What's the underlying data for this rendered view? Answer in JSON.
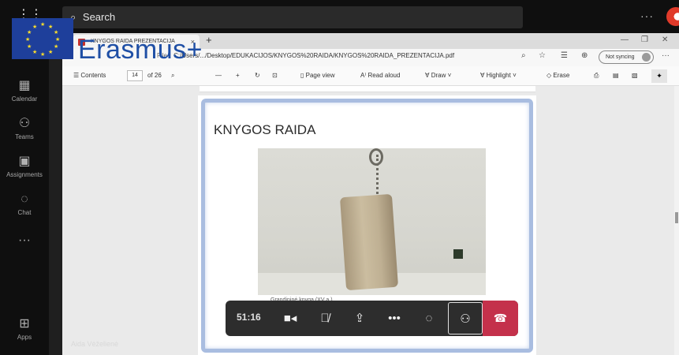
{
  "teams": {
    "search_placeholder": "Search",
    "more": "···",
    "rail": [
      {
        "label": "Calendar",
        "icon": "calendar-icon"
      },
      {
        "label": "Teams",
        "icon": "teams-icon"
      },
      {
        "label": "Assignments",
        "icon": "assignments-icon"
      },
      {
        "label": "Chat",
        "icon": "chat-icon"
      },
      {
        "label": "",
        "icon": "more-apps-icon"
      },
      {
        "label": "Apps",
        "icon": "apps-icon"
      }
    ]
  },
  "browser": {
    "tab_title": "KNYGOS RAIDA PREZENTACIJA",
    "address_prefix": "File",
    "address": "C:/Users/.../Desktop/EDUKACIJOS/KNYGOS%20RAIDA/KNYGOS%20RAIDA_PREZENTACIJA.pdf",
    "sync_label": "Not syncing"
  },
  "pdf_toolbar": {
    "contents": "Contents",
    "page_current": "14",
    "page_total": "of 26",
    "page_view": "Page view",
    "read_aloud": "Read aloud",
    "draw": "Draw",
    "highlight": "Highlight",
    "erase": "Erase"
  },
  "slide": {
    "title": "KNYGOS RAIDA",
    "caption": "Grandininė knyga  (XV a.)"
  },
  "meeting": {
    "timer": "51:16",
    "participant_name": "Aida Vėželienė"
  },
  "logo": {
    "text": "Erasmus+"
  },
  "colors": {
    "hangup": "#c4314b",
    "erasmus_blue": "#1f4fa5",
    "eu_flag": "#1e3f9b"
  }
}
